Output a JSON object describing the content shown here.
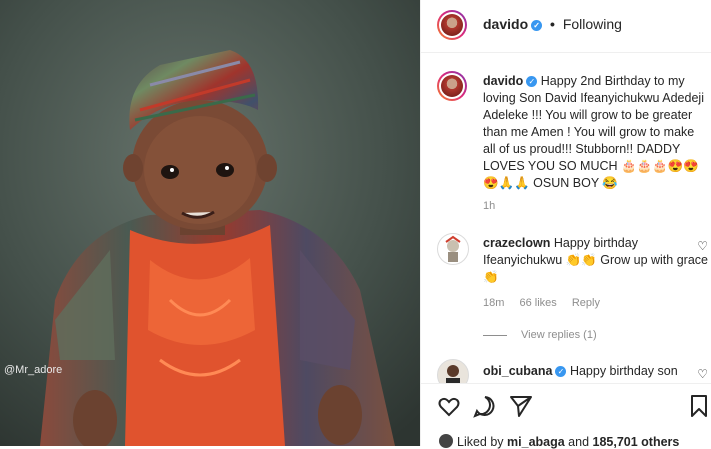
{
  "photo": {
    "watermark": "@Mr_adore"
  },
  "header": {
    "username": "davido",
    "separator": "•",
    "follow_status": "Following"
  },
  "caption": {
    "username": "davido",
    "text": "Happy 2nd Birthday to my loving Son David Ifeanyichukwu Adedeji Adeleke !!! You will grow to be greater than me Amen ! You will grow to make all of us proud!!! Stubborn!! DADDY LOVES YOU SO MUCH 🎂🎂🎂😍😍😍🙏🙏 OSUN BOY 😂",
    "time": "1h"
  },
  "comments": [
    {
      "username": "crazeclown",
      "text": "Happy birthday Ifeanyichukwu 👏👏 Grow up with grace 👏",
      "time": "18m",
      "likes": "66 likes",
      "reply": "Reply"
    },
    {
      "username": "obi_cubana",
      "text": "Happy birthday son"
    }
  ],
  "view_replies": "View replies (1)",
  "likes": {
    "prefix": "Liked by ",
    "user": "mi_abaga",
    "mid": " and ",
    "count": "185,701 others"
  },
  "icons": {
    "like": "heart-icon",
    "comment": "comment-icon",
    "share": "share-icon",
    "save": "bookmark-icon",
    "verified": "verified-badge-icon"
  }
}
